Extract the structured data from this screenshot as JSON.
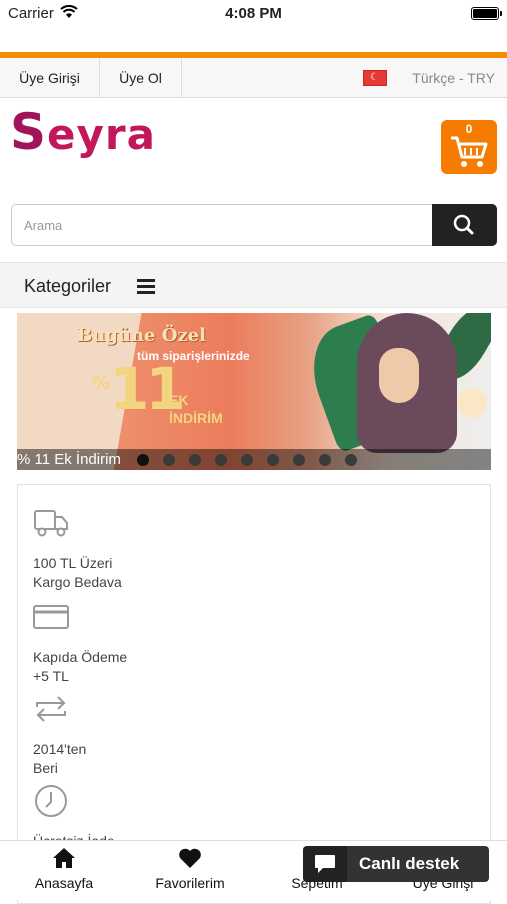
{
  "status_bar": {
    "carrier": "Carrier",
    "time": "4:08 PM"
  },
  "top_links": {
    "login": "Üye Girişi",
    "register": "Üye Ol",
    "language": "Türkçe - TRY"
  },
  "logo": {
    "text": "eyra",
    "initial": "S"
  },
  "cart": {
    "count": "0"
  },
  "search": {
    "placeholder": "Arama"
  },
  "categories": {
    "label": "Kategoriler"
  },
  "banner": {
    "headline": "Bugüne Özel",
    "subline": "tüm siparişlerinizde",
    "percent_sign": "%",
    "number": "11",
    "ek": "EK",
    "indirim": "İNDİRİM",
    "caption": "% 11 Ek İndirim",
    "slide_count": 9,
    "active_slide": 1
  },
  "features": [
    {
      "icon": "truck-icon",
      "line1": "100 TL Üzeri",
      "line2": "Kargo Bedava"
    },
    {
      "icon": "credit-card-icon",
      "line1": "Kapıda Ödeme",
      "line2": "+5 TL"
    },
    {
      "icon": "repeat-icon",
      "line1": "2014'ten",
      "line2": "Beri"
    },
    {
      "icon": "clock-icon",
      "line1": "Ücretsiz İade",
      "line2": ""
    }
  ],
  "bottom_nav": [
    {
      "icon": "home-icon",
      "label": "Anasayfa"
    },
    {
      "icon": "heart-icon",
      "label": "Favorilerim"
    },
    {
      "icon": "cart-icon",
      "label": "Sepetim"
    },
    {
      "icon": "user-icon",
      "label": "Üye Girişi"
    }
  ],
  "chat": {
    "label": "Canlı destek"
  },
  "colors": {
    "accent": "#f28c00",
    "brand": "#c2185b",
    "cart": "#f57c00"
  }
}
